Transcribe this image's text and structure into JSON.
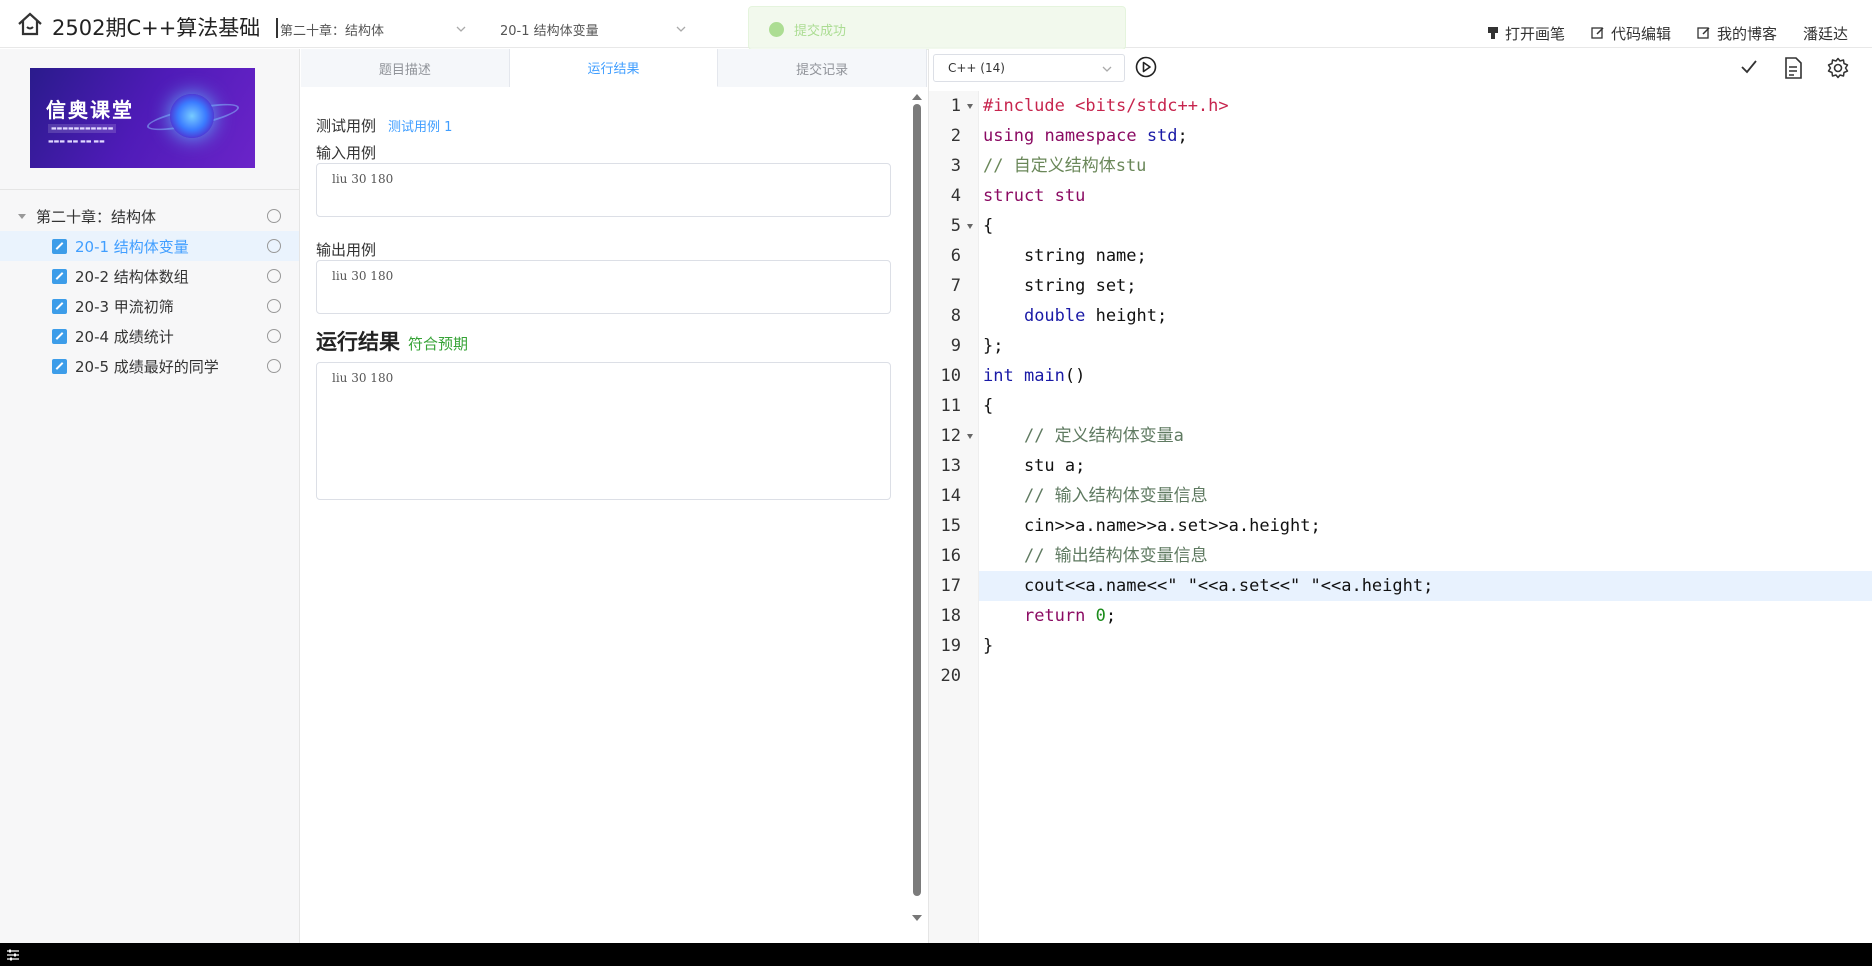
{
  "header": {
    "course_title": "2502期C++算法基础",
    "chapter_select": "第二十章：结构体",
    "section_select": "20-1 结构体变量",
    "toast": "提交成功",
    "actions": [
      "打开画笔",
      "代码编辑",
      "我的博客"
    ],
    "user": "潘廷达"
  },
  "sidebar": {
    "banner_title": "信奥课堂",
    "chapter": "第二十章：结构体",
    "items": [
      {
        "label": "20-1 结构体变量",
        "active": true
      },
      {
        "label": "20-2 结构体数组",
        "active": false
      },
      {
        "label": "20-3 甲流初筛",
        "active": false
      },
      {
        "label": "20-4 成绩统计",
        "active": false
      },
      {
        "label": "20-5 成绩最好的同学",
        "active": false
      }
    ]
  },
  "tabs": [
    "题目描述",
    "运行结果",
    "提交记录"
  ],
  "active_tab": "运行结果",
  "result": {
    "testcase_label": "测试用例",
    "testcase_link": "测试用例 1",
    "input_label": "输入用例",
    "input_value": "liu 30 180",
    "output_label": "输出用例",
    "output_value": "liu 30 180",
    "run_label": "运行结果",
    "run_status": "符合预期",
    "run_value": "liu 30 180"
  },
  "editor": {
    "language": "C++ (14)",
    "line_numbers": [
      "1",
      "2",
      "3",
      "4",
      "5",
      "6",
      "7",
      "8",
      "9",
      "10",
      "11",
      "12",
      "13",
      "14",
      "15",
      "16",
      "17",
      "18",
      "19",
      "20"
    ],
    "highlighted_line": 17
  },
  "colors": {
    "accent": "#409eff",
    "success": "#36a336",
    "sidebar_bg": "#f7f7f8"
  }
}
